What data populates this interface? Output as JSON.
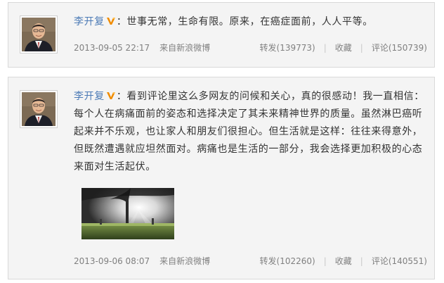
{
  "posts": [
    {
      "author": "李开复",
      "text": "：世事无常，生命有限。原来，在癌症面前，人人平等。",
      "time": "2013-09-05 22:17",
      "source": "来自新浪微博",
      "repost": "转发(139773)",
      "favorite": "收藏",
      "comment": "评论(150739)"
    },
    {
      "author": "李开复",
      "text": "：看到评论里这么多网友的问候和关心，真的很感动！我一直相信：每个人在病痛面前的姿态和选择决定了其未来精神世界的质量。虽然淋巴癌听起来并不乐观，也让家人和朋友们很担心。但生活就是这样：往往来得意外，但既然遭遇就应坦然面对。病痛也是生活的一部分，我会选择更加积极的心态来面对生活起伏。",
      "time": "2013-09-06 08:07",
      "source": "来自新浪微博",
      "repost": "转发(102260)",
      "favorite": "收藏",
      "comment": "评论(140551)"
    }
  ],
  "icons": {
    "verified_badge": "verified-v-icon",
    "avatar": "avatar-portrait",
    "photo": "sunlit-tree-photo"
  },
  "colors": {
    "author_link": "#4d7bb6",
    "body_text": "#333333",
    "meta_text": "#808080",
    "card_bg": "#f4f4f4",
    "card_border": "#d9d9d9",
    "verified_badge": "#f08c00"
  }
}
